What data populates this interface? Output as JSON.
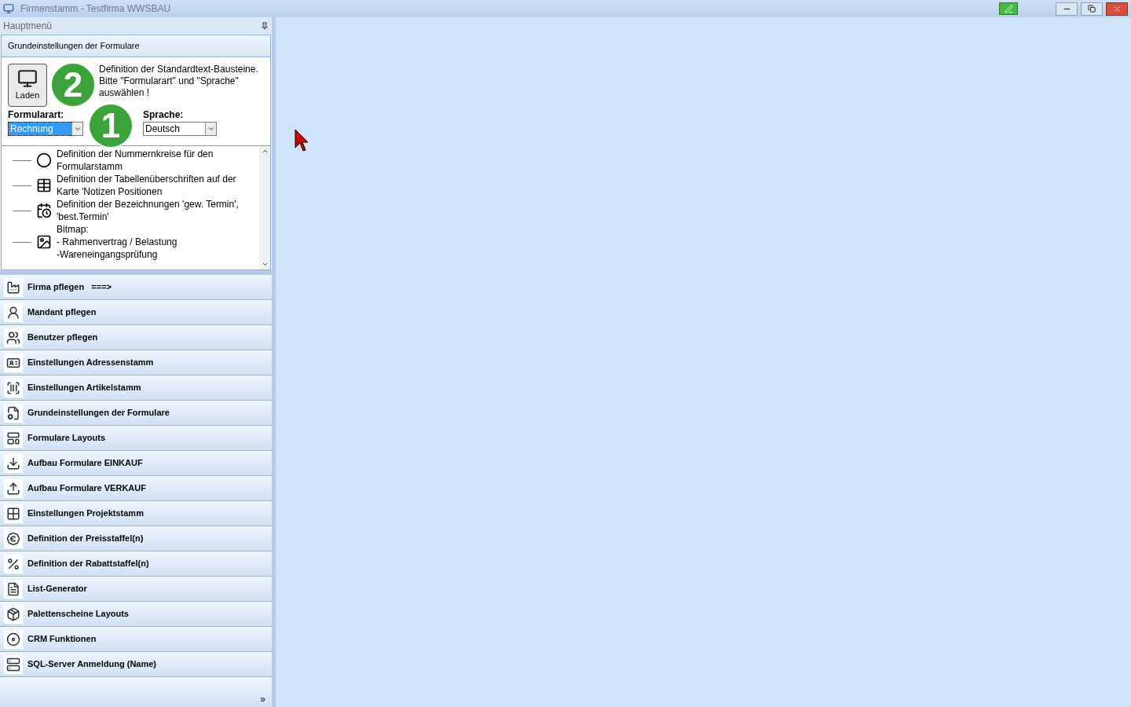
{
  "window": {
    "title": "Firmenstamm - Testfirma WWSBAU"
  },
  "panel": {
    "title": "Hauptmenü"
  },
  "section": {
    "title": "Grundeinstellungen der Formulare",
    "load_button": "Laden",
    "description": "Definition der Standardtext-Bausteine. Bitte \"Formularart\" und \"Sprache\" auswählen !",
    "fields": [
      {
        "label": "Formularart:",
        "value": "Rechnung",
        "focused": true
      },
      {
        "label": "Sprache:",
        "value": "Deutsch",
        "focused": false
      }
    ],
    "markers": [
      "2",
      "1"
    ],
    "tree": [
      {
        "kind": "circle",
        "text": "Definition der Nummernkreise für den Formularstamm"
      },
      {
        "kind": "table",
        "text": "Definition der Tabellenüberschriften auf der Karte 'Notizen Positionen"
      },
      {
        "kind": "calendar",
        "text": "Definition der Bezeichnungen 'gew. Termin', 'best.Termin'"
      },
      {
        "kind": "image",
        "text": "Bitmap:\n- Rahmenvertrag / Belastung\n-Wareneingangsprüfung"
      }
    ]
  },
  "menu": [
    {
      "label": "Firma pflegen   ===>"
    },
    {
      "label": "Mandant pflegen"
    },
    {
      "label": "Benutzer pflegen"
    },
    {
      "label": "Einstellungen Adressenstamm"
    },
    {
      "label": "Einstellungen Artikelstamm"
    },
    {
      "label": "Grundeinstellungen der Formulare"
    },
    {
      "label": "Formulare Layouts"
    },
    {
      "label": "Aufbau Formulare EINKAUF"
    },
    {
      "label": "Aufbau Formulare VERKAUF"
    },
    {
      "label": "Einstellungen Projektstamm"
    },
    {
      "label": "Definition der Preisstaffel(n)"
    },
    {
      "label": "Definition der Rabattstaffel(n)"
    },
    {
      "label": "List-Generator"
    },
    {
      "label": "Palettenscheine Layouts"
    },
    {
      "label": "CRM Funktionen"
    },
    {
      "label": "SQL-Server Anmeldung (Name)"
    }
  ],
  "more": "»"
}
